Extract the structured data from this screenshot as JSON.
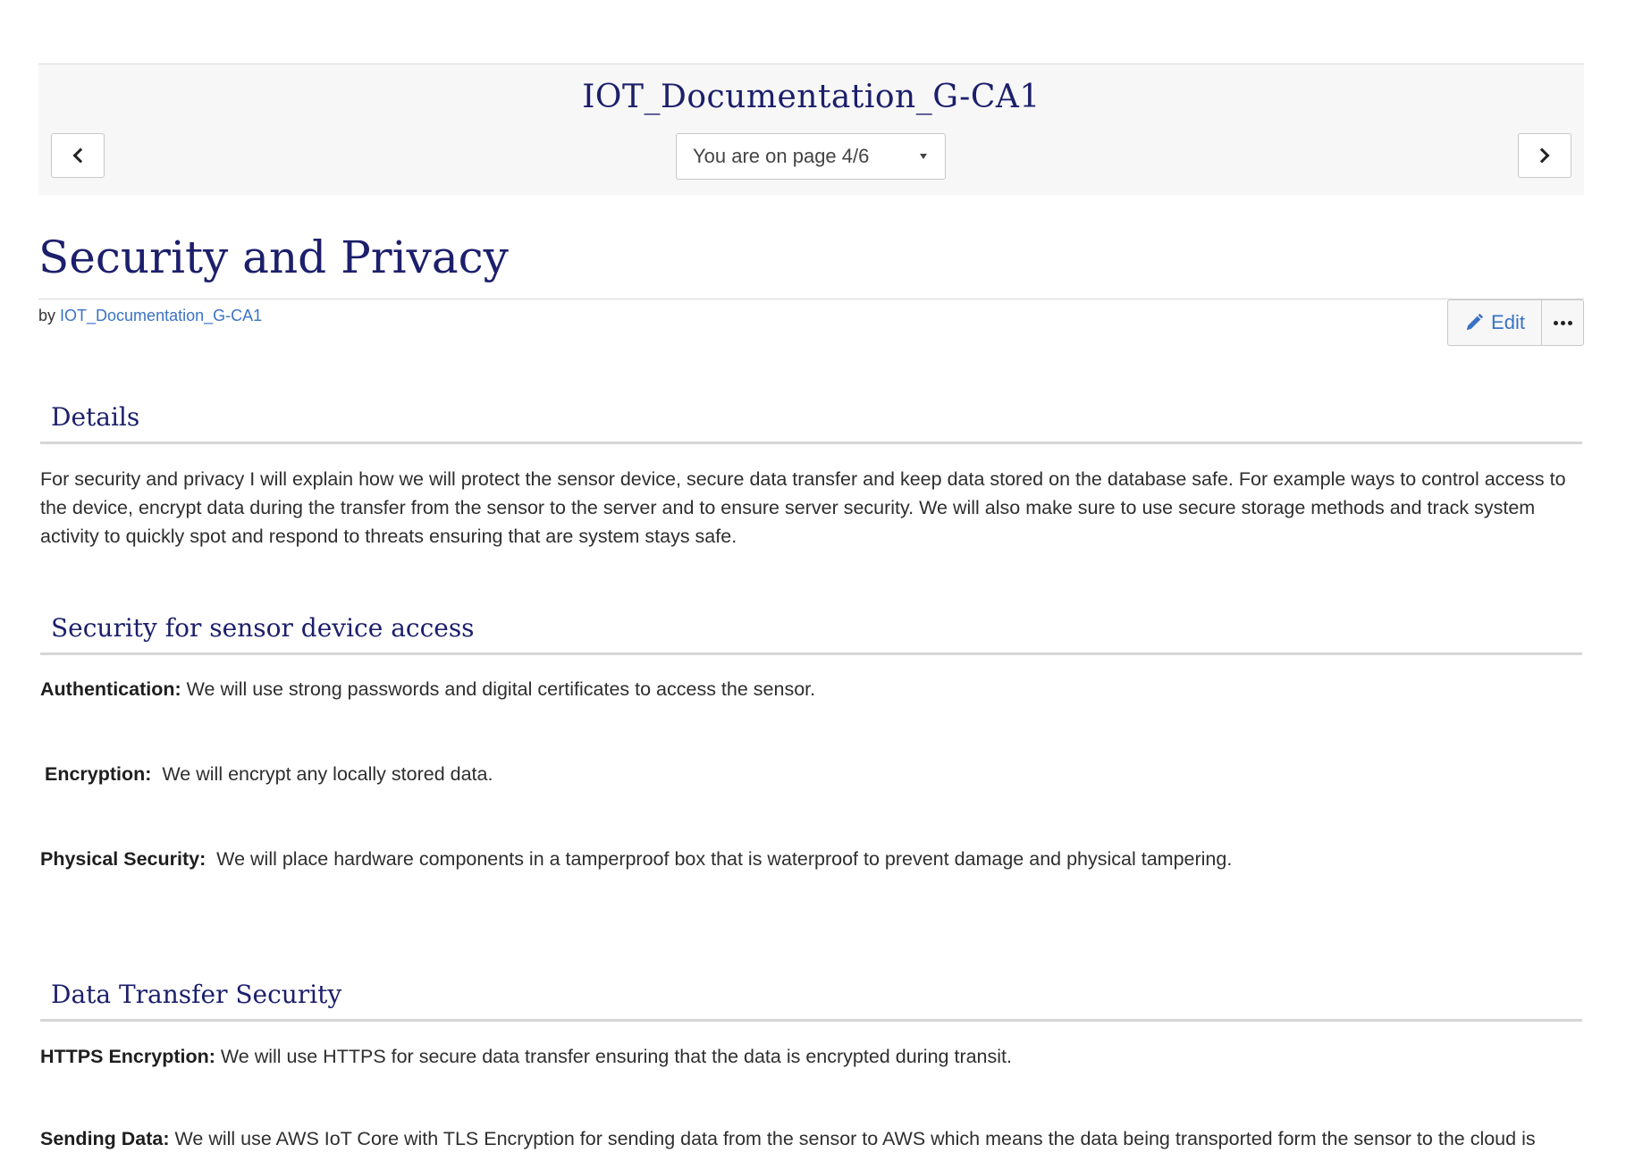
{
  "nav": {
    "doc_title": "IOT_Documentation_G-CA1",
    "page_indicator": "You are on page 4/6"
  },
  "page": {
    "title": "Security and Privacy",
    "by_label": "by",
    "author": "IOT_Documentation_G-CA1",
    "edit_label": "Edit"
  },
  "sections": {
    "details": {
      "heading": "Details",
      "text": "For security and privacy I will explain how we will protect the sensor device, secure data transfer and keep data stored on the database safe. For example ways to control access to the device, encrypt data during the transfer from the sensor to the server and to ensure server security. We will also make sure to use secure storage methods and track system activity to quickly spot and respond to threats ensuring that are system stays safe."
    },
    "sensor_access": {
      "heading": "Security for sensor device access",
      "items": [
        {
          "label": "Authentication:",
          "text": " We will use strong passwords and digital certificates to access the sensor."
        },
        {
          "label": "Encryption:",
          "text": "  We will encrypt any locally stored data."
        },
        {
          "label": "Physical Security:",
          "text": "  We will place hardware components in a tamperproof box that is waterproof to prevent damage and physical tampering."
        }
      ]
    },
    "data_transfer": {
      "heading": "Data Transfer Security",
      "items": [
        {
          "label": "HTTPS Encryption:",
          "text": " We will use HTTPS for secure data transfer ensuring that the data is encrypted during transit."
        },
        {
          "label": "Sending Data:",
          "text": " We will use AWS IoT Core with TLS Encryption for sending data from the sensor to AWS which means the data being transported form the sensor to the cloud is"
        }
      ]
    }
  },
  "colors": {
    "heading": "#1c1f6b",
    "link": "#3a73c4",
    "nav_bg": "#f7f7f7"
  }
}
